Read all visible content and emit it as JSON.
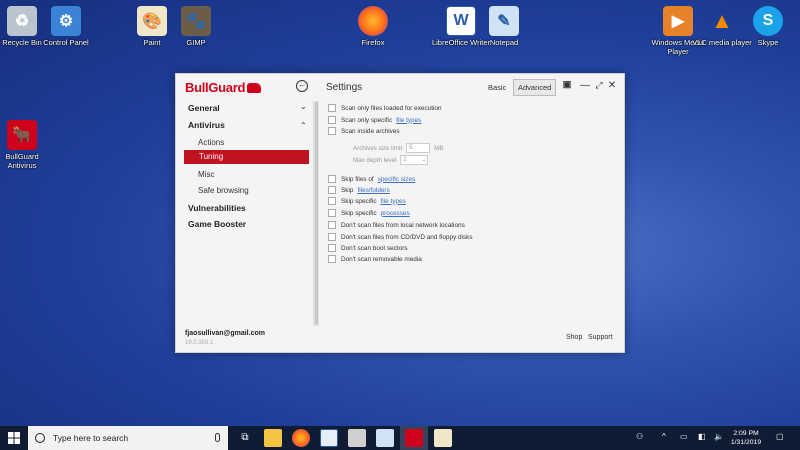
{
  "desktop": {
    "icons": [
      {
        "label": "Recycle Bin"
      },
      {
        "label": "Control Panel"
      },
      {
        "label": "Paint"
      },
      {
        "label": "GIMP"
      },
      {
        "label": "Firefox"
      },
      {
        "label": "LibreOffice Writer"
      },
      {
        "label": "Notepad"
      },
      {
        "label": "Windows Media Player"
      },
      {
        "label": "VLC media player"
      },
      {
        "label": "Skype"
      },
      {
        "label": "BullGuard Antivirus"
      }
    ]
  },
  "app": {
    "brand": "BullGuard",
    "title": "Settings",
    "mode_basic": "Basic",
    "mode_advanced": "Advanced",
    "sidebar": {
      "general": "General",
      "antivirus": "Antivirus",
      "sub": [
        "Actions",
        "Tuning",
        "Misc",
        "Safe browsing"
      ],
      "vulnerabilities": "Vulnerabilities",
      "game_booster": "Game Booster"
    },
    "options": [
      {
        "label": "Scan only files loaded for execution",
        "link": ""
      },
      {
        "label": "Scan only specific",
        "link": "file types"
      },
      {
        "label": "Scan inside archives",
        "link": ""
      },
      {
        "label": "Skip files of",
        "link": "specific sizes"
      },
      {
        "label": "Skip",
        "link": "files/folders"
      },
      {
        "label": "Skip specific",
        "link": "file types"
      },
      {
        "label": "Skip specific",
        "link": "processes"
      },
      {
        "label": "Don't scan files from local network locations",
        "link": ""
      },
      {
        "label": "Don't scan files from CD/DVD and floppy disks",
        "link": ""
      },
      {
        "label": "Don't scan boot sectors",
        "link": ""
      },
      {
        "label": "Don't scan removable media",
        "link": ""
      }
    ],
    "archives_size_limit": {
      "label": "Archives size limit",
      "value": "5",
      "unit": "MB"
    },
    "max_depth_level": {
      "label": "Max depth level",
      "value": "2"
    },
    "footer": {
      "email": "fjaosullivan@gmail.com",
      "version": "19.0.359.1",
      "shop": "Shop",
      "support": "Support"
    },
    "accent_color": "#c1121f"
  },
  "taskbar": {
    "search_placeholder": "Type here to search",
    "time": "2:09 PM",
    "date": "1/31/2019"
  }
}
